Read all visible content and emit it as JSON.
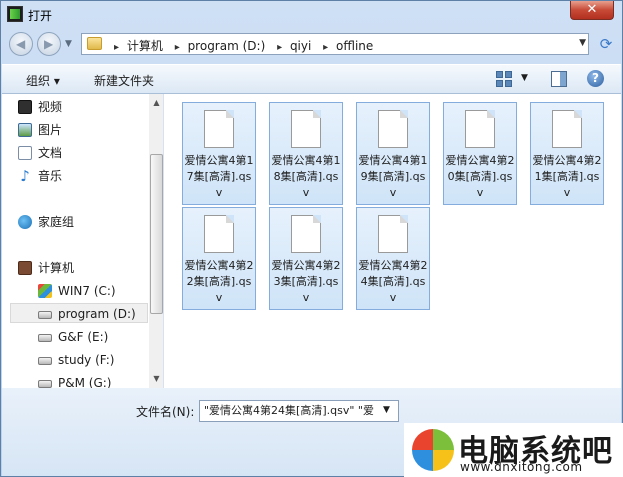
{
  "window": {
    "title": "打开",
    "close_label": "✕"
  },
  "address": {
    "crumbs": [
      "计算机",
      "program (D:)",
      "qiyi",
      "offline"
    ]
  },
  "toolbar": {
    "organize_label": "组织 ▾",
    "new_folder_label": "新建文件夹"
  },
  "nav": {
    "libraries": [
      {
        "label": "视频",
        "icon": "video-library-icon"
      },
      {
        "label": "图片",
        "icon": "picture-library-icon"
      },
      {
        "label": "文档",
        "icon": "document-library-icon"
      },
      {
        "label": "音乐",
        "icon": "music-library-icon"
      }
    ],
    "homegroup": "家庭组",
    "computer": "计算机",
    "drives": [
      {
        "label": "WIN7 (C:)",
        "icon": "system-drive-icon",
        "selected": false
      },
      {
        "label": "program (D:)",
        "icon": "drive-icon",
        "selected": true
      },
      {
        "label": "G&F (E:)",
        "icon": "drive-icon",
        "selected": false
      },
      {
        "label": "study (F:)",
        "icon": "drive-icon",
        "selected": false
      },
      {
        "label": "P&M (G:)",
        "icon": "drive-icon",
        "selected": false
      }
    ]
  },
  "files": [
    {
      "name": "爱情公寓4第17集[高清].qsv"
    },
    {
      "name": "爱情公寓4第18集[高清].qsv"
    },
    {
      "name": "爱情公寓4第19集[高清].qsv"
    },
    {
      "name": "爱情公寓4第20集[高清].qsv"
    },
    {
      "name": "爱情公寓4第21集[高清].qsv"
    },
    {
      "name": "爱情公寓4第22集[高清].qsv"
    },
    {
      "name": "爱情公寓4第23集[高清].qsv"
    },
    {
      "name": "爱情公寓4第24集[高清].qsv"
    }
  ],
  "footer": {
    "filename_label": "文件名(N):",
    "filename_value": "\"爱情公寓4第24集[高清].qsv\" \"爱"
  },
  "watermark": {
    "title": "电脑系统吧",
    "url": "www.dnxitong.com"
  },
  "colors": {
    "accent": "#84acdd",
    "selection": "#cfe4f8"
  }
}
